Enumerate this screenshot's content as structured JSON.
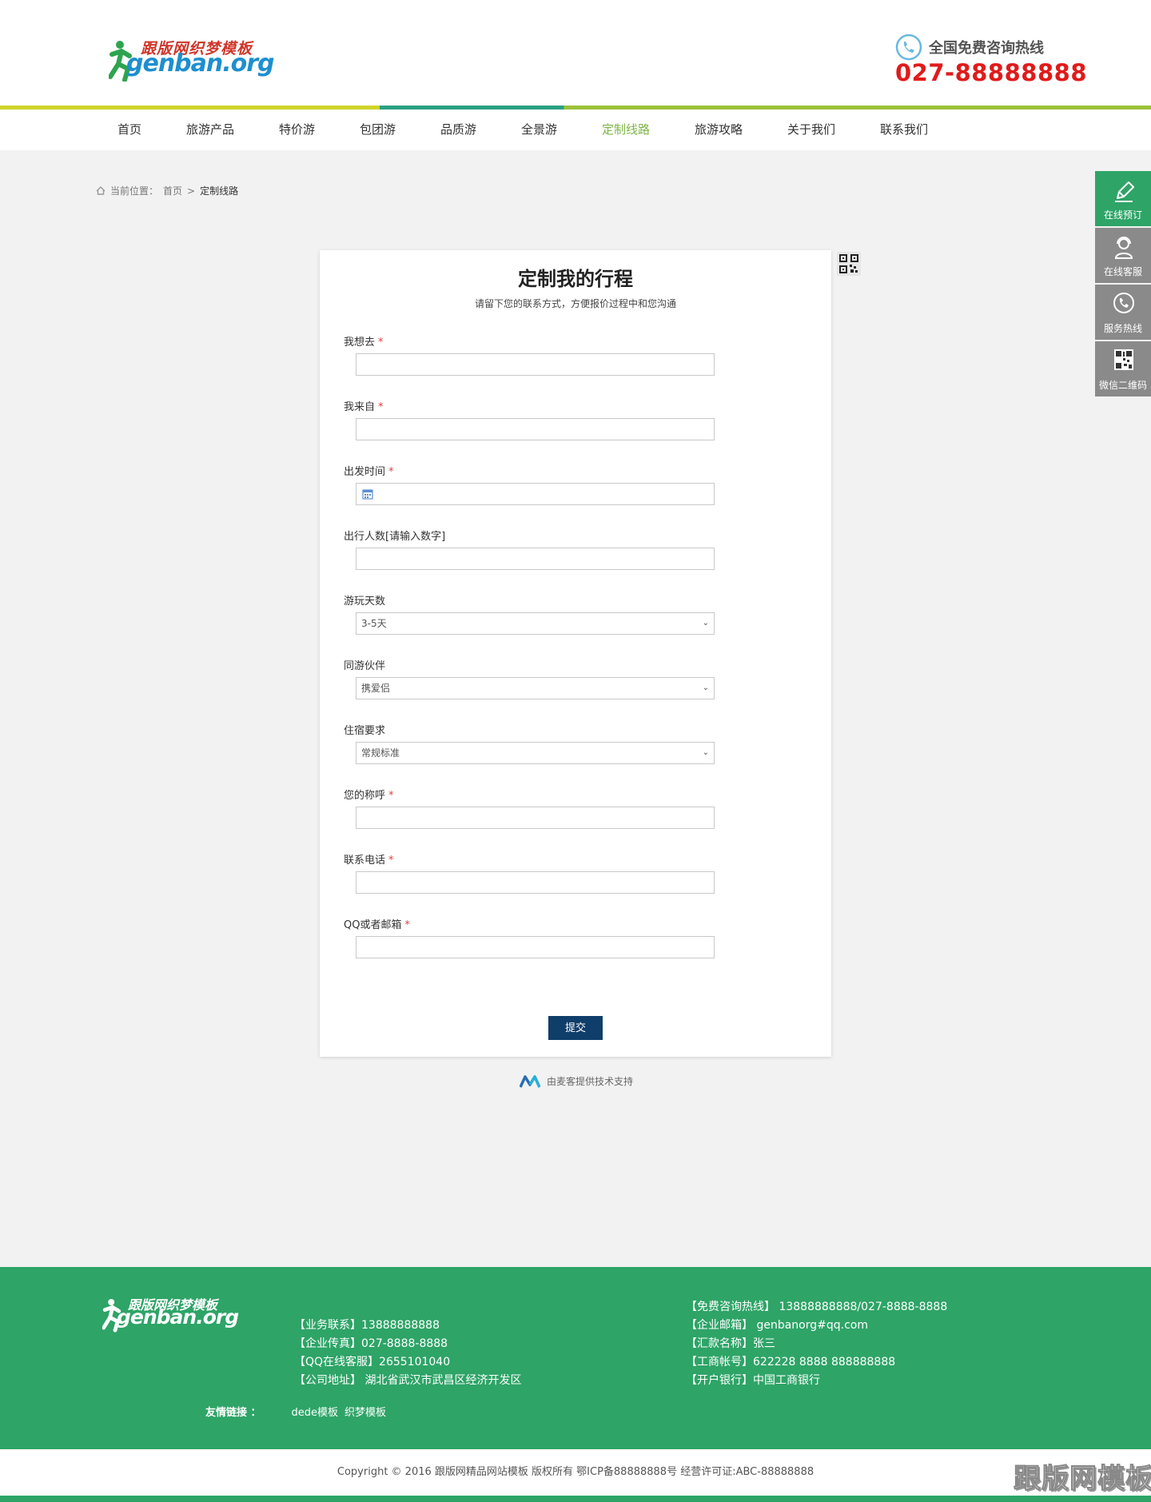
{
  "logo": {
    "cn": "跟版网织梦模板",
    "en": "genban.org"
  },
  "hotline": {
    "label": "全国免费咨询热线",
    "number": "027-88888888"
  },
  "nav": [
    {
      "label": "首页"
    },
    {
      "label": "旅游产品"
    },
    {
      "label": "特价游"
    },
    {
      "label": "包团游"
    },
    {
      "label": "品质游"
    },
    {
      "label": "全景游"
    },
    {
      "label": "定制线路",
      "active": true
    },
    {
      "label": "旅游攻略"
    },
    {
      "label": "关于我们"
    },
    {
      "label": "联系我们"
    }
  ],
  "breadcrumb": {
    "prefix": "当前位置：",
    "home": "首页",
    "sep": ">",
    "current": "定制线路"
  },
  "sidebar": [
    {
      "label": "在线预订",
      "icon": "pencil-icon"
    },
    {
      "label": "在线客服",
      "icon": "headset-icon"
    },
    {
      "label": "服务热线",
      "icon": "phone-icon"
    },
    {
      "label": "微信二维码",
      "icon": "qrcode-icon"
    }
  ],
  "form": {
    "title": "定制我的行程",
    "subtitle": "请留下您的联系方式，方便报价过程中和您沟通",
    "fields": [
      {
        "label": "我想去",
        "required": "*",
        "value": ""
      },
      {
        "label": "我来自",
        "required": "*",
        "value": ""
      },
      {
        "label": "出发时间",
        "required": "*",
        "value": ""
      },
      {
        "label": "出行人数[请输入数字]",
        "required": "",
        "value": ""
      },
      {
        "label": "游玩天数",
        "required": "",
        "value": "3-5天"
      },
      {
        "label": "同游伙伴",
        "required": "",
        "value": "携爱侣"
      },
      {
        "label": "住宿要求",
        "required": "",
        "value": "常规标准"
      },
      {
        "label": "您的称呼",
        "required": "*",
        "value": ""
      },
      {
        "label": "联系电话",
        "required": "*",
        "value": ""
      },
      {
        "label": "QQ或者邮箱",
        "required": "*",
        "value": ""
      }
    ],
    "submit": "提交"
  },
  "powered": "由麦客提供技术支持",
  "footer": {
    "logo_cn": "跟版网织梦模板",
    "logo_en": "genban.org",
    "left": [
      "【业务联系】13888888888",
      "【企业传真】027-8888-8888",
      "【QQ在线客服】2655101040",
      "【公司地址】 湖北省武汉市武昌区经济开发区"
    ],
    "right": [
      "【免费咨询热线】 13888888888/027-8888-8888",
      "【企业邮箱】  genbanorg#qq.com",
      "【汇款名称】张三",
      "【工商帐号】622228 8888 888888888",
      "【开户银行】中国工商银行"
    ],
    "links_title": "友情链接 ：",
    "links": [
      "dede模板",
      "织梦模板"
    ]
  },
  "copyright": "Copyright © 2016   跟版网精品网站模板   版权所有 鄂ICP备88888888号   经营许可证:ABC-88888888",
  "watermark": "跟版网模板",
  "colors": {
    "green": "#2ea467",
    "nav_active": "#7eb444",
    "hotline": "#e01b1b",
    "submit": "#0f3e6a"
  }
}
